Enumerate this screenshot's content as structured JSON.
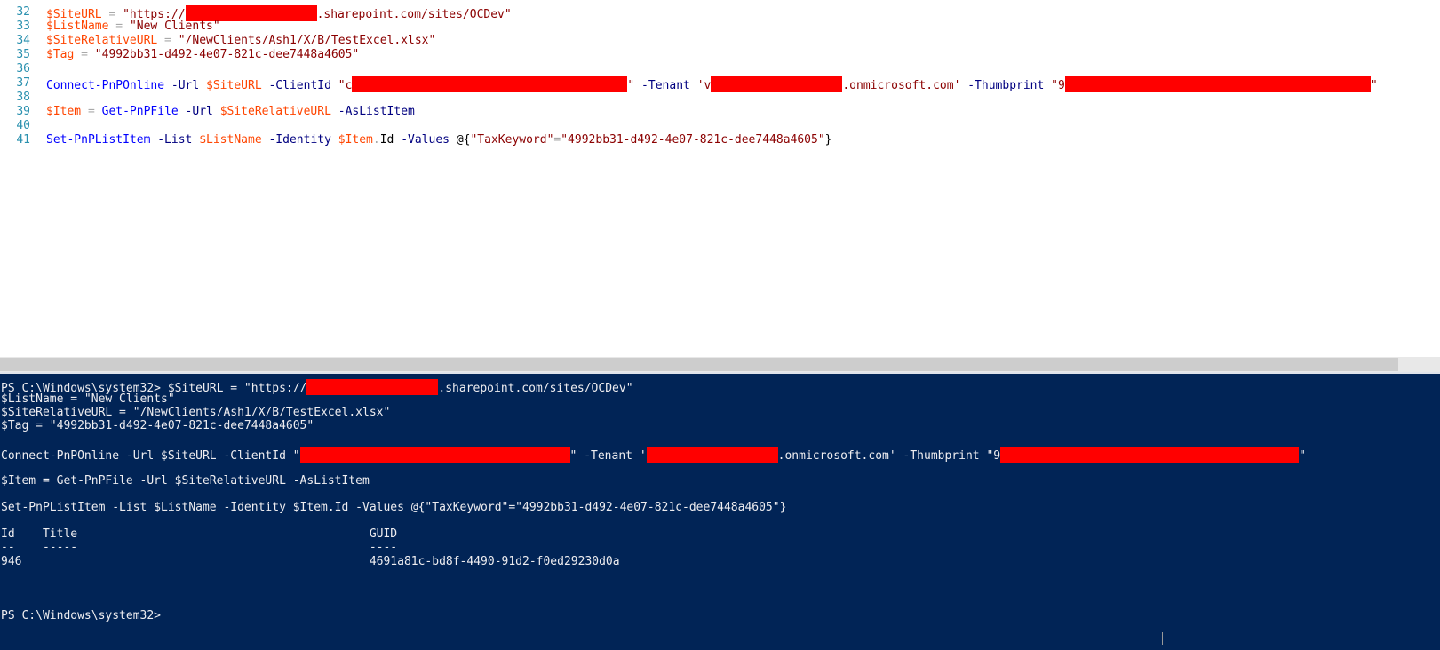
{
  "editor": {
    "lines": [
      {
        "num": "32",
        "parts": [
          [
            "v",
            "$SiteURL"
          ],
          [
            "o",
            " = "
          ],
          [
            "s",
            "\"https://"
          ],
          [
            "red",
            ""
          ],
          [
            "s",
            ".sharepoint.com/sites/OCDev\""
          ]
        ]
      },
      {
        "num": "33",
        "parts": [
          [
            "v",
            "$ListName"
          ],
          [
            "o",
            " = "
          ],
          [
            "s",
            "\"New Clients\""
          ]
        ]
      },
      {
        "num": "34",
        "parts": [
          [
            "v",
            "$SiteRelativeURL"
          ],
          [
            "o",
            " = "
          ],
          [
            "s",
            "\"/NewClients/Ash1/X/B/TestExcel.xlsx\""
          ]
        ]
      },
      {
        "num": "35",
        "parts": [
          [
            "v",
            "$Tag"
          ],
          [
            "o",
            " = "
          ],
          [
            "s",
            "\"4992bb31-d492-4e07-821c-dee7448a4605\""
          ]
        ]
      },
      {
        "num": "36",
        "parts": []
      },
      {
        "num": "37",
        "parts": [
          [
            "c",
            "Connect-PnPOnline"
          ],
          [
            "p",
            " -Url "
          ],
          [
            "v",
            "$SiteURL"
          ],
          [
            "p",
            " -ClientId "
          ],
          [
            "s",
            "\"c"
          ],
          [
            "red",
            ""
          ],
          [
            "s",
            "\""
          ],
          [
            "p",
            " -Tenant "
          ],
          [
            "s",
            "'v"
          ],
          [
            "red",
            ""
          ],
          [
            "s",
            ".onmicrosoft.com'"
          ],
          [
            "p",
            " -Thumbprint "
          ],
          [
            "s",
            "\"9"
          ],
          [
            "red",
            ""
          ],
          [
            "s",
            "\""
          ]
        ]
      },
      {
        "num": "38",
        "parts": []
      },
      {
        "num": "39",
        "parts": [
          [
            "v",
            "$Item"
          ],
          [
            "o",
            " = "
          ],
          [
            "c",
            "Get-PnPFile"
          ],
          [
            "p",
            " -Url "
          ],
          [
            "v",
            "$SiteRelativeURL"
          ],
          [
            "p",
            " -AsListItem"
          ]
        ]
      },
      {
        "num": "40",
        "parts": []
      },
      {
        "num": "41",
        "parts": [
          [
            "c",
            "Set-PnPListItem"
          ],
          [
            "p",
            " -List "
          ],
          [
            "v",
            "$ListName"
          ],
          [
            "p",
            " -Identity "
          ],
          [
            "v",
            "$Item"
          ],
          [
            "o",
            "."
          ],
          [
            "t",
            "Id"
          ],
          [
            "p",
            " -Values "
          ],
          [
            "t",
            "@{"
          ],
          [
            "s",
            "\"TaxKeyword\""
          ],
          [
            "o",
            "="
          ],
          [
            "s",
            "\"4992bb31-d492-4e07-821c-dee7448a4605\""
          ],
          [
            "t",
            "}"
          ]
        ]
      }
    ]
  },
  "console": {
    "lines": [
      [
        "PS C:\\Windows\\system32> $SiteURL = \"https://",
        "@red",
        ".sharepoint.com/sites/OCDev\""
      ],
      [
        "$ListName = \"New Clients\""
      ],
      [
        "$SiteRelativeURL = \"/NewClients/Ash1/X/B/TestExcel.xlsx\""
      ],
      [
        "$Tag = \"4992bb31-d492-4e07-821c-dee7448a4605\""
      ],
      [
        ""
      ],
      [
        "Connect-PnPOnline -Url $SiteURL -ClientId \"",
        "@red",
        "\" -Tenant '",
        "@red",
        ".onmicrosoft.com' -Thumbprint \"9",
        "@red",
        "\""
      ],
      [
        ""
      ],
      [
        "$Item = Get-PnPFile -Url $SiteRelativeURL -AsListItem"
      ],
      [
        ""
      ],
      [
        "Set-PnPListItem -List $ListName -Identity $Item.Id -Values @{\"TaxKeyword\"=\"4992bb31-d492-4e07-821c-dee7448a4605\"}"
      ],
      [
        ""
      ],
      [
        "Id    Title                                          GUID"
      ],
      [
        "--    -----                                          ----"
      ],
      [
        "946                                                  4691a81c-bd8f-4490-91d2-f0ed29230d0a"
      ],
      [
        ""
      ],
      [
        ""
      ],
      [
        ""
      ],
      [
        "PS C:\\Windows\\system32>"
      ]
    ]
  }
}
